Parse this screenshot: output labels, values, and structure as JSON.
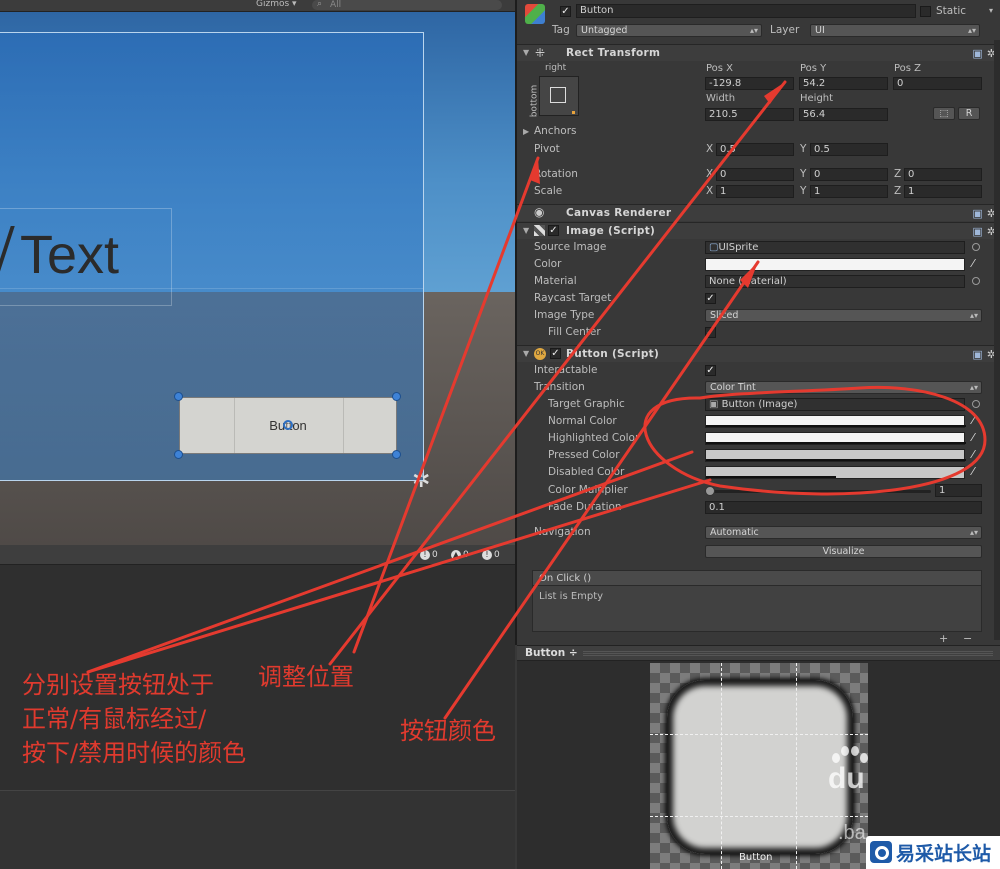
{
  "scene": {
    "gizmos_label": "Gizmos ▾",
    "search_placeholder": "All",
    "canvas_text": "Text",
    "button_label": "Button",
    "console_counts": [
      "0",
      "0",
      "0"
    ]
  },
  "inspector": {
    "object": {
      "name": "Button",
      "active": true,
      "static_label": "Static",
      "tag_label": "Tag",
      "tag_value": "Untagged",
      "layer_label": "Layer",
      "layer_value": "UI"
    },
    "rect_transform": {
      "title": "Rect Transform",
      "anchor_top_label": "right",
      "anchor_side_label": "bottom",
      "pos_x_label": "Pos X",
      "pos_y_label": "Pos Y",
      "pos_z_label": "Pos Z",
      "pos_x": "-129.8",
      "pos_y": "54.2",
      "pos_z": "0",
      "width_label": "Width",
      "height_label": "Height",
      "width": "210.5",
      "height": "56.4",
      "r_button": "R",
      "anchors_label": "Anchors",
      "pivot_label": "Pivot",
      "pivot_x": "0.5",
      "pivot_y": "0.5",
      "rotation_label": "Rotation",
      "rot_x": "0",
      "rot_y": "0",
      "rot_z": "0",
      "scale_label": "Scale",
      "scale_x": "1",
      "scale_y": "1",
      "scale_z": "1",
      "axis_x": "X",
      "axis_y": "Y",
      "axis_z": "Z"
    },
    "canvas_renderer": {
      "title": "Canvas Renderer"
    },
    "image": {
      "title": "Image (Script)",
      "source_image_label": "Source Image",
      "source_image": "UISprite",
      "color_label": "Color",
      "material_label": "Material",
      "material": "None (Material)",
      "raycast_label": "Raycast Target",
      "image_type_label": "Image Type",
      "image_type": "Sliced",
      "fill_center_label": "Fill Center"
    },
    "button": {
      "title": "Button (Script)",
      "interactable_label": "Interactable",
      "transition_label": "Transition",
      "transition": "Color Tint",
      "target_graphic_label": "Target Graphic",
      "target_graphic": "Button (Image)",
      "normal_label": "Normal Color",
      "highlighted_label": "Highlighted Color",
      "pressed_label": "Pressed Color",
      "disabled_label": "Disabled Color",
      "multiplier_label": "Color Multiplier",
      "multiplier_value": "1",
      "fade_label": "Fade Duration",
      "fade_value": "0.1",
      "navigation_label": "Navigation",
      "navigation": "Automatic",
      "visualize_label": "Visualize",
      "onclick_label": "On Click ()",
      "list_empty": "List is Empty",
      "add_label": "+",
      "remove_label": "−"
    }
  },
  "preview": {
    "title": "Button ÷",
    "sprite_caption": "Button"
  },
  "annotations": {
    "states_note": [
      "分别设置按钮处于",
      "正常/有鼠标经过/",
      "按下/禁用时候的颜色"
    ],
    "position_note": "调整位置",
    "color_note": "按钮颜色",
    "annotation_color": "#e03a2e"
  },
  "watermark": {
    "baidu_text": "du",
    "baidu_tail": ".ba",
    "site_name": "易采站长站"
  },
  "colors": {
    "panel_bg": "#383838",
    "sky_top": "#2e66a4",
    "handle_blue": "#3e82d6"
  }
}
